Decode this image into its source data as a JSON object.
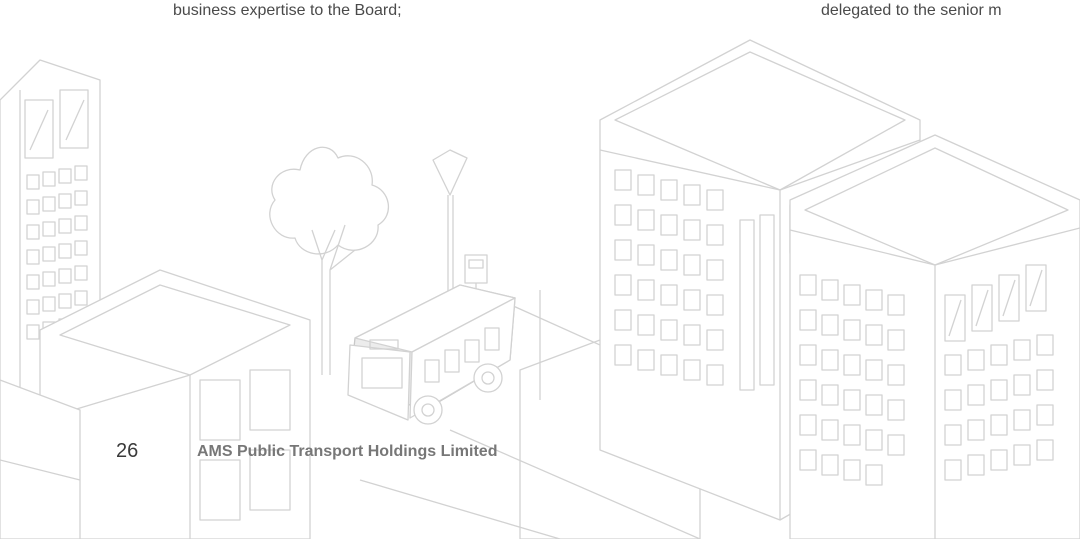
{
  "page": {
    "text_left": "business expertise to the Board;",
    "text_right": "delegated to the senior m",
    "page_number": "26",
    "company_name": "AMS Public Transport Holdings Limited"
  },
  "illustration": {
    "subject": "city-street-line-drawing",
    "icons": [
      "building-icon",
      "tree-icon",
      "street-lamp-icon",
      "bus-stop-sign-icon",
      "minibus-icon"
    ]
  }
}
